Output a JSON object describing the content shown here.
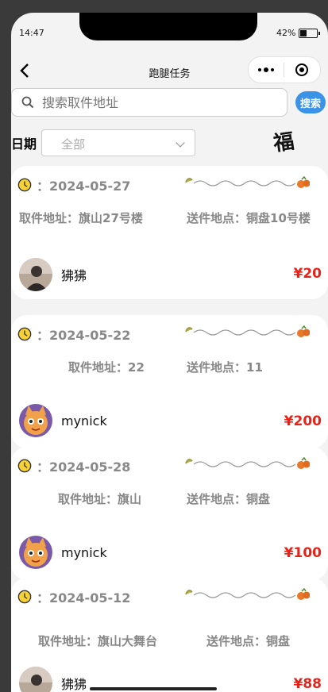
{
  "status_bar": {
    "time": "14:47",
    "battery": "42%"
  },
  "nav": {
    "title": "跑腿任务"
  },
  "search": {
    "placeholder": "搜索取件地址",
    "button": "搜索"
  },
  "filter": {
    "label": "日期",
    "selected": "全部",
    "decoration": "福"
  },
  "tasks": [
    {
      "date": "2024-05-27",
      "pickup": "取件地址：旗山27号楼",
      "delivery": "送件地点：铜盘10号楼",
      "user": "狒狒",
      "price": "¥20"
    },
    {
      "date": "2024-05-22",
      "pickup": "取件地址：22",
      "delivery": "送件地点：11",
      "user": "mynick",
      "price": "¥200"
    },
    {
      "date": "2024-05-28",
      "pickup": "取件地址：旗山",
      "delivery": "送件地点：铜盘",
      "user": "mynick",
      "price": "¥100"
    },
    {
      "date": "2024-05-12",
      "pickup": "取件地址：旗山大舞台",
      "delivery": "送件地点：铜盘",
      "user": "狒狒",
      "price": "¥88"
    }
  ],
  "date_prefix": "："
}
